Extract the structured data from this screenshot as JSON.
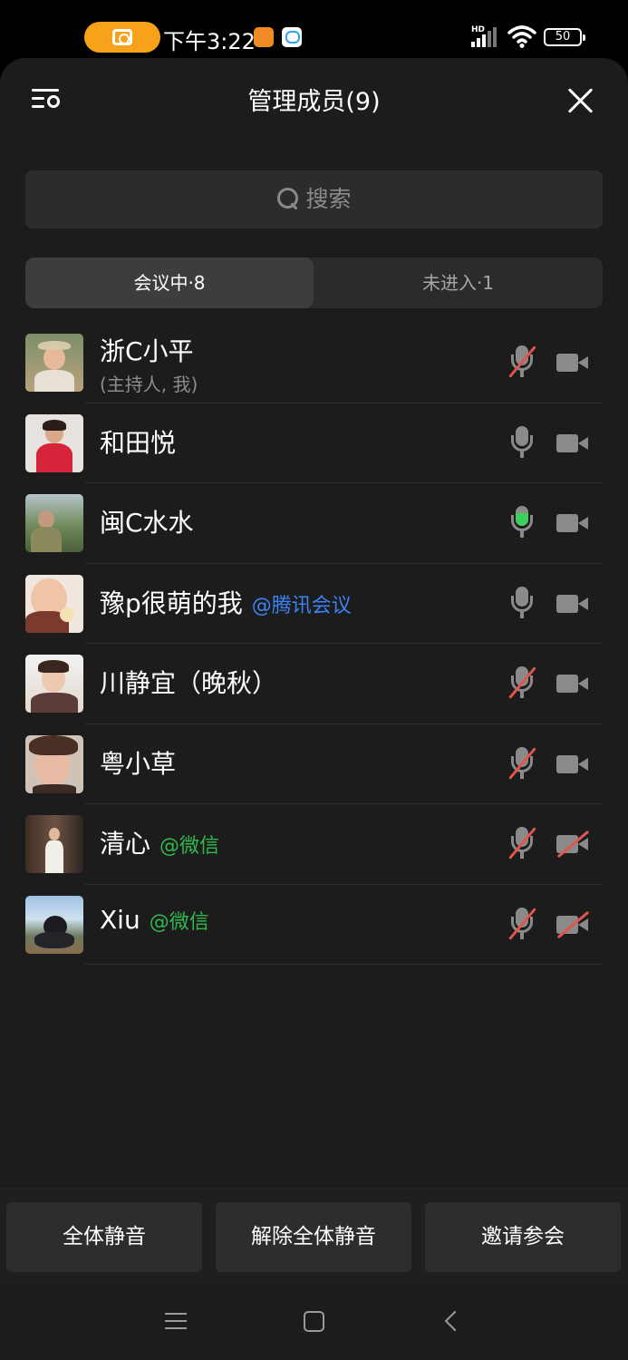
{
  "status_bar": {
    "time": "下午3:22",
    "hd_label": "HD",
    "battery": "50"
  },
  "header": {
    "title": "管理成员(9)"
  },
  "search": {
    "placeholder": "搜索"
  },
  "tabs": [
    {
      "label": "会议中·8",
      "active": true
    },
    {
      "label": "未进入·1",
      "active": false
    }
  ],
  "members": [
    {
      "name": "浙C小平",
      "role": "(主持人, 我)",
      "source": "",
      "mic": "muted",
      "camera": "off-neutral"
    },
    {
      "name": "和田悦",
      "role": "",
      "source": "",
      "mic": "on",
      "camera": "on"
    },
    {
      "name": "闽C水水",
      "role": "",
      "source": "",
      "mic": "speaking",
      "camera": "on"
    },
    {
      "name": "豫p很萌的我",
      "role": "",
      "source": "@腾讯会议",
      "mic": "on",
      "camera": "on"
    },
    {
      "name": "川静宜（晚秋）",
      "role": "",
      "source": "",
      "mic": "muted",
      "camera": "on"
    },
    {
      "name": "粤小草",
      "role": "",
      "source": "",
      "mic": "muted",
      "camera": "on"
    },
    {
      "name": "清心",
      "role": "",
      "source": "@微信",
      "mic": "muted",
      "camera": "disabled"
    },
    {
      "name": "Xiu",
      "role": "",
      "source": "@微信",
      "mic": "muted",
      "camera": "disabled"
    }
  ],
  "actions": {
    "mute_all": "全体静音",
    "unmute_all": "解除全体静音",
    "invite": "邀请参会"
  },
  "colors": {
    "tencent_source": "#3d83f5",
    "wechat_source": "#30b84e",
    "muted_slash": "#e0554e",
    "speaking": "#3fcf5c",
    "recording_pill": "#f7a21a"
  },
  "icons": [
    "camera-icon",
    "signal-icon",
    "wifi-icon",
    "battery-icon",
    "manage-settings-icon",
    "close-icon",
    "search-icon",
    "microphone-icon",
    "video-camera-icon",
    "menu-icon",
    "home-icon",
    "back-icon"
  ]
}
